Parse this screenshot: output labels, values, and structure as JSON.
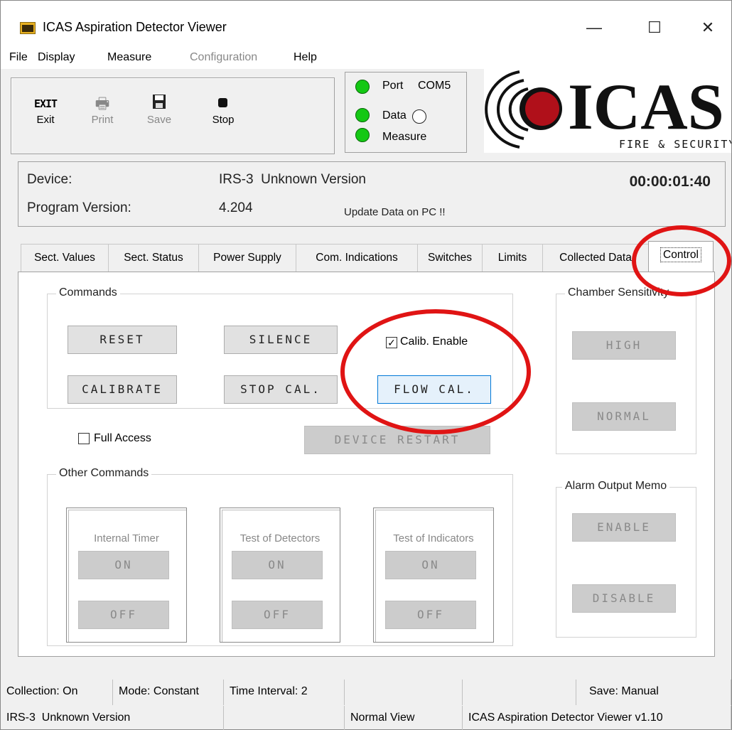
{
  "window": {
    "title": "ICAS Aspiration Detector Viewer",
    "controls": {
      "minimize": "—",
      "maximize": "☐",
      "close": "✕"
    }
  },
  "menu": {
    "items": [
      {
        "label": "File"
      },
      {
        "label": "Display"
      },
      {
        "label": "Measure"
      },
      {
        "label": "Configuration"
      },
      {
        "label": "Help"
      }
    ]
  },
  "toolbar": {
    "exit": {
      "icon_text": "EXIT",
      "label": "Exit"
    },
    "print": {
      "label": "Print"
    },
    "save": {
      "label": "Save"
    },
    "stop": {
      "label": "Stop"
    }
  },
  "status_leds": {
    "port_label": "Port",
    "port_value": "COM5",
    "data_label": "Data",
    "measure_label": "Measure",
    "led_color": "#14c814"
  },
  "logo": {
    "brand": "ICAS",
    "tagline": "FIRE & SECURITY",
    "dot_color": "#b0101a"
  },
  "info": {
    "device_label": "Device:",
    "device_value": "IRS-3  Unknown Version",
    "program_label": "Program Version:",
    "program_value": "4.204",
    "update_notice": "Update Data on PC !!",
    "elapsed": "00:00:01:40"
  },
  "tabs": [
    {
      "label": "Sect. Values"
    },
    {
      "label": "Sect. Status"
    },
    {
      "label": "Power Supply"
    },
    {
      "label": "Com. Indications"
    },
    {
      "label": "Switches"
    },
    {
      "label": "Limits"
    },
    {
      "label": "Collected Data"
    },
    {
      "label": "Control"
    }
  ],
  "control": {
    "commands": {
      "title": "Commands",
      "reset": "RESET",
      "silence": "SILENCE",
      "calibrate": "CALIBRATE",
      "stop_cal": "STOP CAL.",
      "flow_cal": "FLOW CAL.",
      "calib_enable": "Calib. Enable",
      "calib_enable_checked": true
    },
    "full_access": {
      "label": "Full Access",
      "checked": false
    },
    "device_restart": "DEVICE RESTART",
    "chamber_sensitivity": {
      "title": "Chamber Sensitivity",
      "high": "HIGH",
      "normal": "NORMAL"
    },
    "other_commands": {
      "title": "Other Commands",
      "internal_timer": {
        "title": "Internal Timer",
        "on": "ON",
        "off": "OFF"
      },
      "test_detectors": {
        "title": "Test of Detectors",
        "on": "ON",
        "off": "OFF"
      },
      "test_indicators": {
        "title": "Test of Indicators",
        "on": "ON",
        "off": "OFF"
      }
    },
    "alarm_output_memo": {
      "title": "Alarm Output Memo",
      "enable": "ENABLE",
      "disable": "DISABLE"
    }
  },
  "statusbar": {
    "row1": [
      "Collection: On",
      "Mode: Constant",
      "Time Interval: 2",
      "",
      "",
      "Save: Manual"
    ],
    "row2": [
      "IRS-3  Unknown Version",
      "",
      "Normal View",
      "ICAS Aspiration Detector Viewer v1.10"
    ]
  },
  "annotation_color": "#e01414"
}
